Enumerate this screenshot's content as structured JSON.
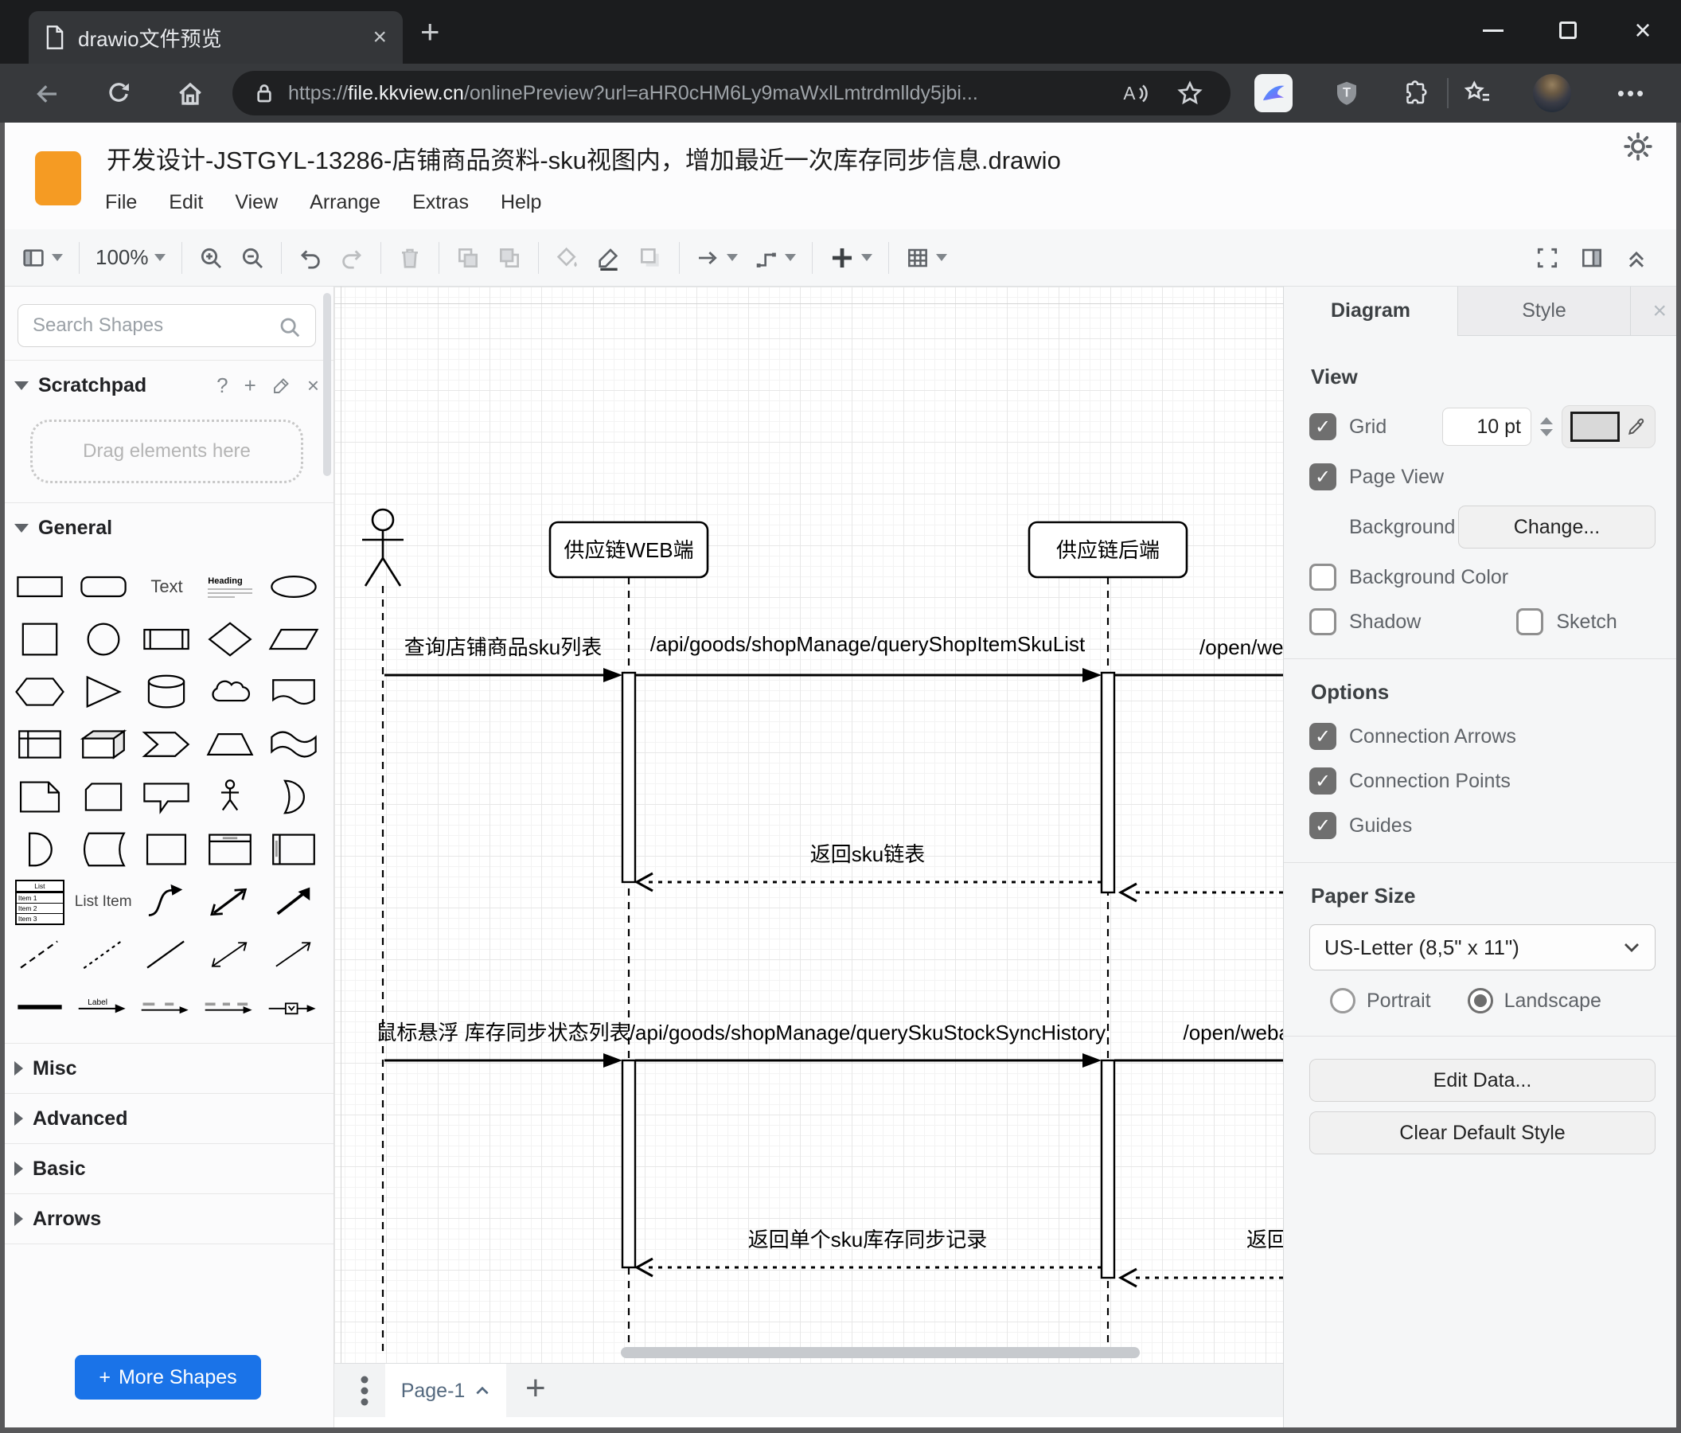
{
  "colors": {
    "logo_orange": "#f59b23",
    "accent_blue": "#1a73e8",
    "diagram_stroke": "#000000",
    "checked_checkbox": "#6f6f6f"
  },
  "browser": {
    "tab_title": "drawio文件预览",
    "url": {
      "scheme": "https://",
      "host": "file.kkview.cn",
      "path": "/onlinePreview?url=aHR0cHM6Ly9maWxlLmtrdmlldy5jbi..."
    },
    "icons": [
      "document-icon",
      "close-icon",
      "new-tab-icon",
      "minimize-icon",
      "maximize-icon",
      "back-arrow-icon",
      "refresh-icon",
      "home-icon",
      "lock-icon",
      "read-aloud-icon",
      "favorite-star-icon",
      "kkview-bird-icon",
      "tampermonkey-shield-icon",
      "extensions-puzzle-icon",
      "collections-icon",
      "avatar",
      "more-menu-icon"
    ]
  },
  "app": {
    "title": "开发设计-JSTGYL-13286-店铺商品资料-sku视图内，增加最近一次库存同步信息.drawio",
    "menus": [
      "File",
      "Edit",
      "View",
      "Arrange",
      "Extras",
      "Help"
    ],
    "zoom_level": "100%",
    "toolbar_icons": [
      "view-icon",
      "zoom-in-icon",
      "zoom-out-icon",
      "undo-icon",
      "redo-icon",
      "delete-icon",
      "to-front-icon",
      "to-back-icon",
      "fill-color-icon",
      "line-color-icon",
      "shadow-icon",
      "connection-icon",
      "waypoints-icon",
      "insert-icon",
      "table-icon",
      "fullscreen-icon",
      "format-panel-icon",
      "collapse-icon",
      "sun-icon"
    ]
  },
  "sidebar": {
    "search_placeholder": "Search Shapes",
    "scratchpad_title": "Scratchpad",
    "drag_hint": "Drag elements here",
    "sections": {
      "general": "General",
      "misc": "Misc",
      "advanced": "Advanced",
      "basic": "Basic",
      "arrows": "Arrows"
    },
    "shapes": [
      "rectangle",
      "rounded-rectangle",
      "text",
      "heading",
      "ellipse",
      "square",
      "circle",
      "process",
      "diamond",
      "parallelogram",
      "hexagon",
      "triangle",
      "cylinder",
      "cloud",
      "document",
      "internal-storage",
      "cube",
      "step",
      "trapezoid",
      "tape",
      "note",
      "card",
      "callout",
      "actor",
      "or",
      "and",
      "data-storage",
      "container",
      "vertical-container",
      "horizontal-container",
      "list",
      "list-item",
      "curve",
      "bidirectional-arrow",
      "arrow",
      "dashed-line",
      "dotted-line",
      "line",
      "bidirectional-connector",
      "directional-connector",
      "horizontal-rule",
      "labeled-arrow",
      "labeled-connector-1",
      "labeled-connector-2",
      "link-edge"
    ],
    "shape_texts": {
      "text": "Text",
      "heading": "Heading",
      "list_title": "List",
      "list_items": [
        "Item 1",
        "Item 2",
        "Item 3"
      ],
      "list_item": "List Item",
      "arrow_label": "Label"
    },
    "more_shapes_label": "More Shapes"
  },
  "canvas": {
    "participants": [
      {
        "label": "供应链WEB端"
      },
      {
        "label": "供应链后端"
      }
    ],
    "messages": {
      "m1": "查询店铺商品sku列表",
      "m2": "/api/goods/shopManage/queryShopItemSkuList",
      "m3": "/open/webapi/",
      "r1": "返回sku链表",
      "m4": "鼠标悬浮 库存同步状态列表",
      "m5": "/api/goods/shopManage/querySkuStockSyncHistory",
      "m6": "/open/webapi/item",
      "r2": "返回单个sku库存同步记录",
      "r3": "返回"
    }
  },
  "panel": {
    "tabs": {
      "diagram": "Diagram",
      "style": "Style"
    },
    "view": {
      "header": "View",
      "grid": "Grid",
      "grid_size": "10 pt",
      "page_view": "Page View",
      "background": "Background",
      "change_button": "Change...",
      "background_color": "Background Color",
      "shadow": "Shadow",
      "sketch": "Sketch"
    },
    "options": {
      "header": "Options",
      "items": [
        "Connection Arrows",
        "Connection Points",
        "Guides"
      ]
    },
    "paper": {
      "header": "Paper Size",
      "size": "US-Letter (8,5\" x 11\")",
      "portrait": "Portrait",
      "landscape": "Landscape"
    },
    "buttons": {
      "edit_data": "Edit Data...",
      "clear_style": "Clear Default Style"
    }
  },
  "footer": {
    "page_tab": "Page-1"
  }
}
